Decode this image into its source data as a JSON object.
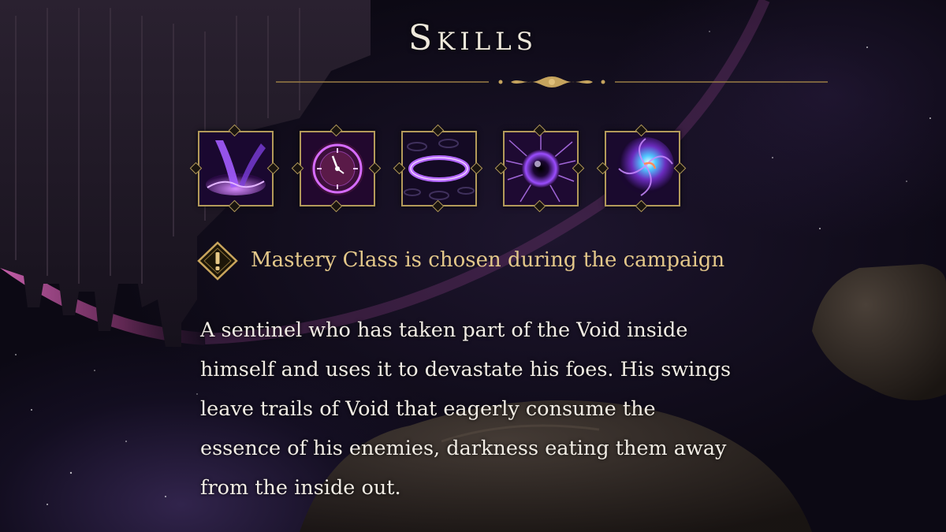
{
  "title": "Skills",
  "skills": [
    {
      "icon": "void-pillar-icon"
    },
    {
      "icon": "void-clock-icon"
    },
    {
      "icon": "void-ring-icon"
    },
    {
      "icon": "void-orb-icon"
    },
    {
      "icon": "void-vortex-icon"
    }
  ],
  "notice": {
    "icon": "warning-diamond-icon",
    "text": "Mastery Class is chosen during the campaign"
  },
  "description": {
    "lines": [
      "A sentinel who has taken part of the Void inside",
      "himself and uses it to devastate his foes. His swings",
      "leave trails of Void that eagerly consume the",
      "essence of his enemies, darkness eating them away",
      "from the inside out."
    ]
  },
  "colors": {
    "gold": "#b39a5a",
    "notice_text": "#e4c88a",
    "title_text": "#efe9dc",
    "body_text": "#f1ece4",
    "void_purple": "#9b4dff"
  }
}
